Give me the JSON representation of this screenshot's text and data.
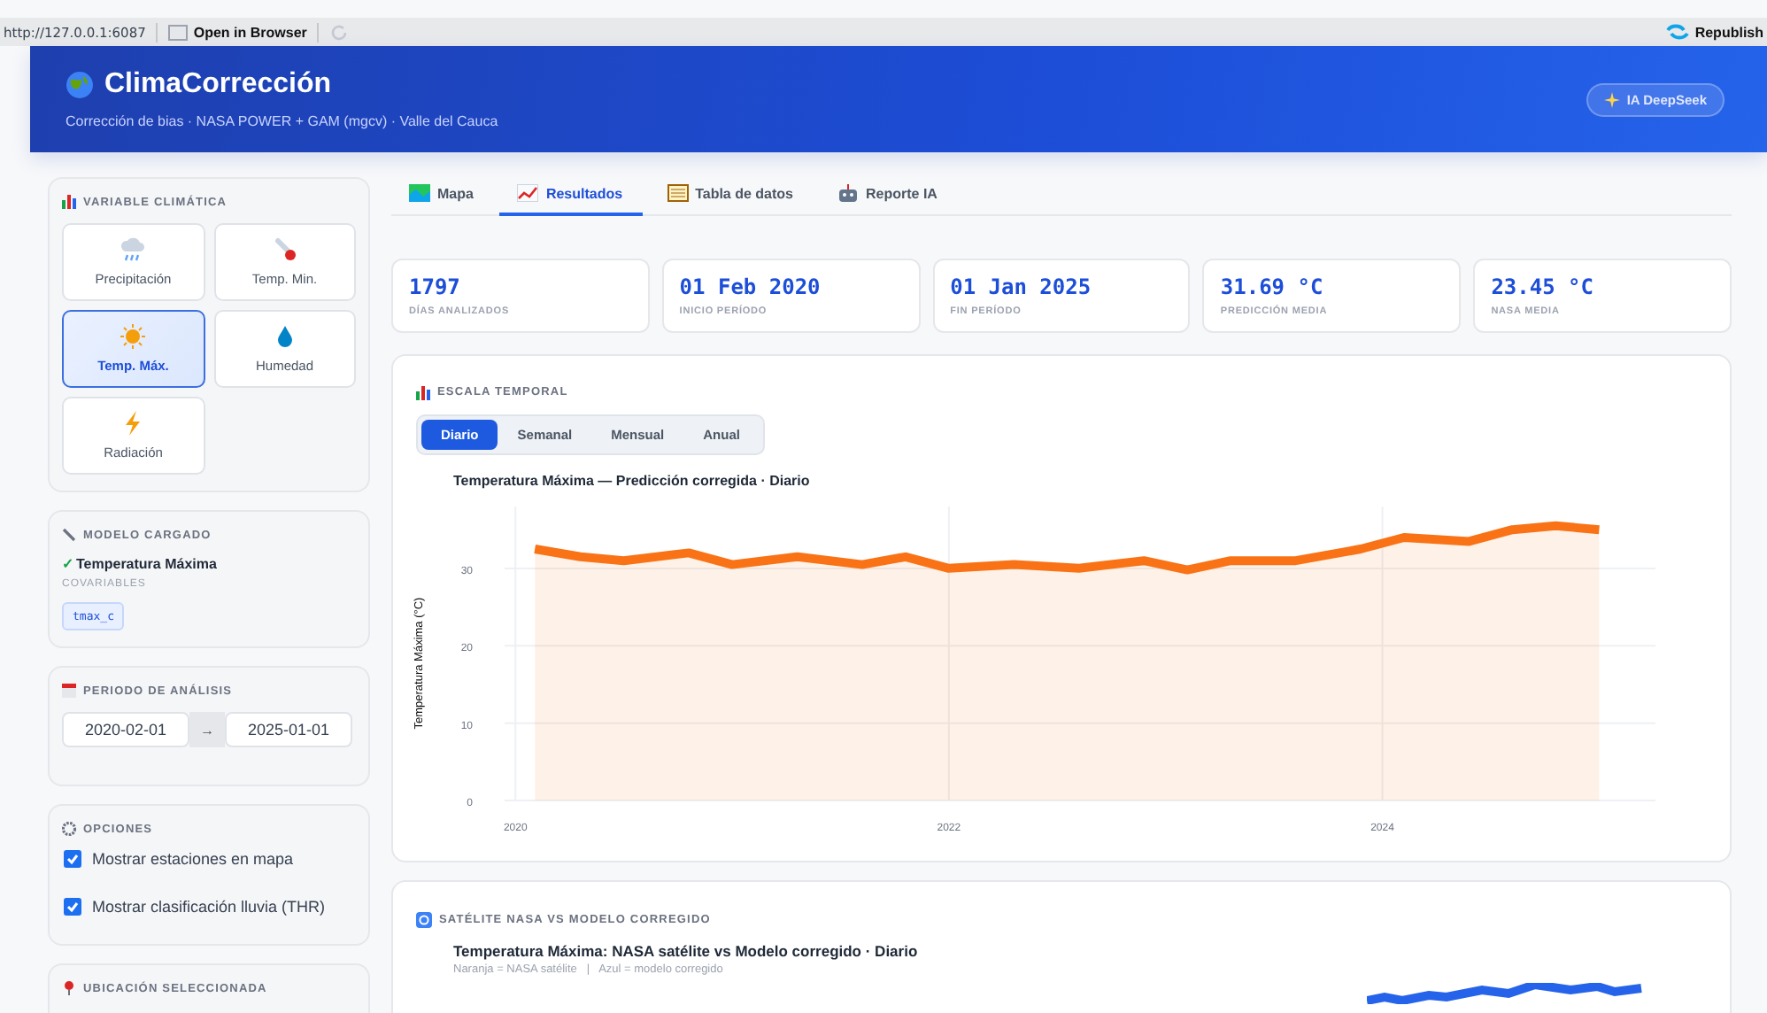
{
  "browser_bar": {
    "url": "http://127.0.0.1:6087",
    "open_label": "Open in Browser",
    "republish_label": "Republish"
  },
  "header": {
    "title": "ClimaCorrección",
    "subtitle": "Corrección de bias · NASA POWER + GAM (mgcv) · Valle del Cauca",
    "ai_button": "IA DeepSeek"
  },
  "sidebar": {
    "variable": {
      "heading": "VARIABLE CLIMÁTICA",
      "options": [
        {
          "label": "Precipitación",
          "kind": "rain",
          "selected": false
        },
        {
          "label": "Temp. Min.",
          "kind": "thermometer",
          "selected": false
        },
        {
          "label": "Temp. Máx.",
          "kind": "sun",
          "selected": true
        },
        {
          "label": "Humedad",
          "kind": "drop",
          "selected": false
        },
        {
          "label": "Radiación",
          "kind": "bolt",
          "selected": false
        }
      ]
    },
    "model": {
      "heading": "MODELO CARGADO",
      "check": "✓",
      "name": "Temperatura Máxima",
      "covariables_label": "COVARIABLES",
      "covariables": [
        "tmax_c"
      ]
    },
    "period": {
      "heading": "PERIODO DE ANÁLISIS",
      "start": "2020-02-01",
      "arrow": "→",
      "end": "2025-01-01"
    },
    "options": {
      "heading": "OPCIONES",
      "items": [
        {
          "label": "Mostrar estaciones en mapa",
          "checked": true
        },
        {
          "label": "Mostrar clasificación lluvia (THR)",
          "checked": true
        }
      ]
    },
    "location": {
      "heading": "UBICACIÓN SELECCIONADA"
    }
  },
  "tabs": [
    {
      "label": "Mapa",
      "kind": "map",
      "selected": false
    },
    {
      "label": "Resultados",
      "kind": "chart",
      "selected": true
    },
    {
      "label": "Tabla de datos",
      "kind": "table",
      "selected": false
    },
    {
      "label": "Reporte IA",
      "kind": "robot",
      "selected": false
    }
  ],
  "stats": [
    {
      "value": "1797",
      "label": "DÍAS ANALIZADOS"
    },
    {
      "value": "01 Feb 2020",
      "label": "INICIO PERÍODO"
    },
    {
      "value": "01 Jan 2025",
      "label": "FIN PERÍODO"
    },
    {
      "value": "31.69 °C",
      "label": "PREDICCIÓN MEDIA"
    },
    {
      "value": "23.45 °C",
      "label": "NASA MEDIA"
    }
  ],
  "scale_panel": {
    "heading": "ESCALA TEMPORAL",
    "scales": [
      {
        "label": "Diario",
        "selected": true
      },
      {
        "label": "Semanal",
        "selected": false
      },
      {
        "label": "Mensual",
        "selected": false
      },
      {
        "label": "Anual",
        "selected": false
      }
    ],
    "chart_data": {
      "type": "line",
      "title": "Temperatura Máxima — Predicción corregida · Diario",
      "ylabel": "Temperatura Máxima (°C)",
      "x": [
        2020.09,
        2020.3,
        2020.5,
        2020.8,
        2021.0,
        2021.3,
        2021.6,
        2021.8,
        2022.0,
        2022.3,
        2022.6,
        2022.9,
        2023.1,
        2023.3,
        2023.6,
        2023.9,
        2024.1,
        2024.4,
        2024.6,
        2024.8,
        2025.0
      ],
      "series": [
        {
          "color": "#f97316",
          "values": [
            32.5,
            31.5,
            31,
            32,
            30.5,
            31.5,
            30.5,
            31.5,
            30,
            30.5,
            30,
            31,
            29.8,
            31,
            31,
            32.5,
            34,
            33.5,
            35,
            35.5,
            35
          ]
        }
      ],
      "xlim": [
        2019.95,
        2025.26
      ],
      "ylim": [
        0,
        38
      ],
      "grid": true,
      "xticks": [
        2020,
        2022,
        2024
      ],
      "yticks": [
        0,
        10,
        20,
        30
      ]
    }
  },
  "compare_panel": {
    "heading": "SATÉLITE NASA VS MODELO CORREGIDO",
    "title": "Temperatura Máxima: NASA satélite vs Modelo corregido · Diario",
    "subtitle": "Naranja = NASA satélite   |   Azul = modelo corregido"
  }
}
